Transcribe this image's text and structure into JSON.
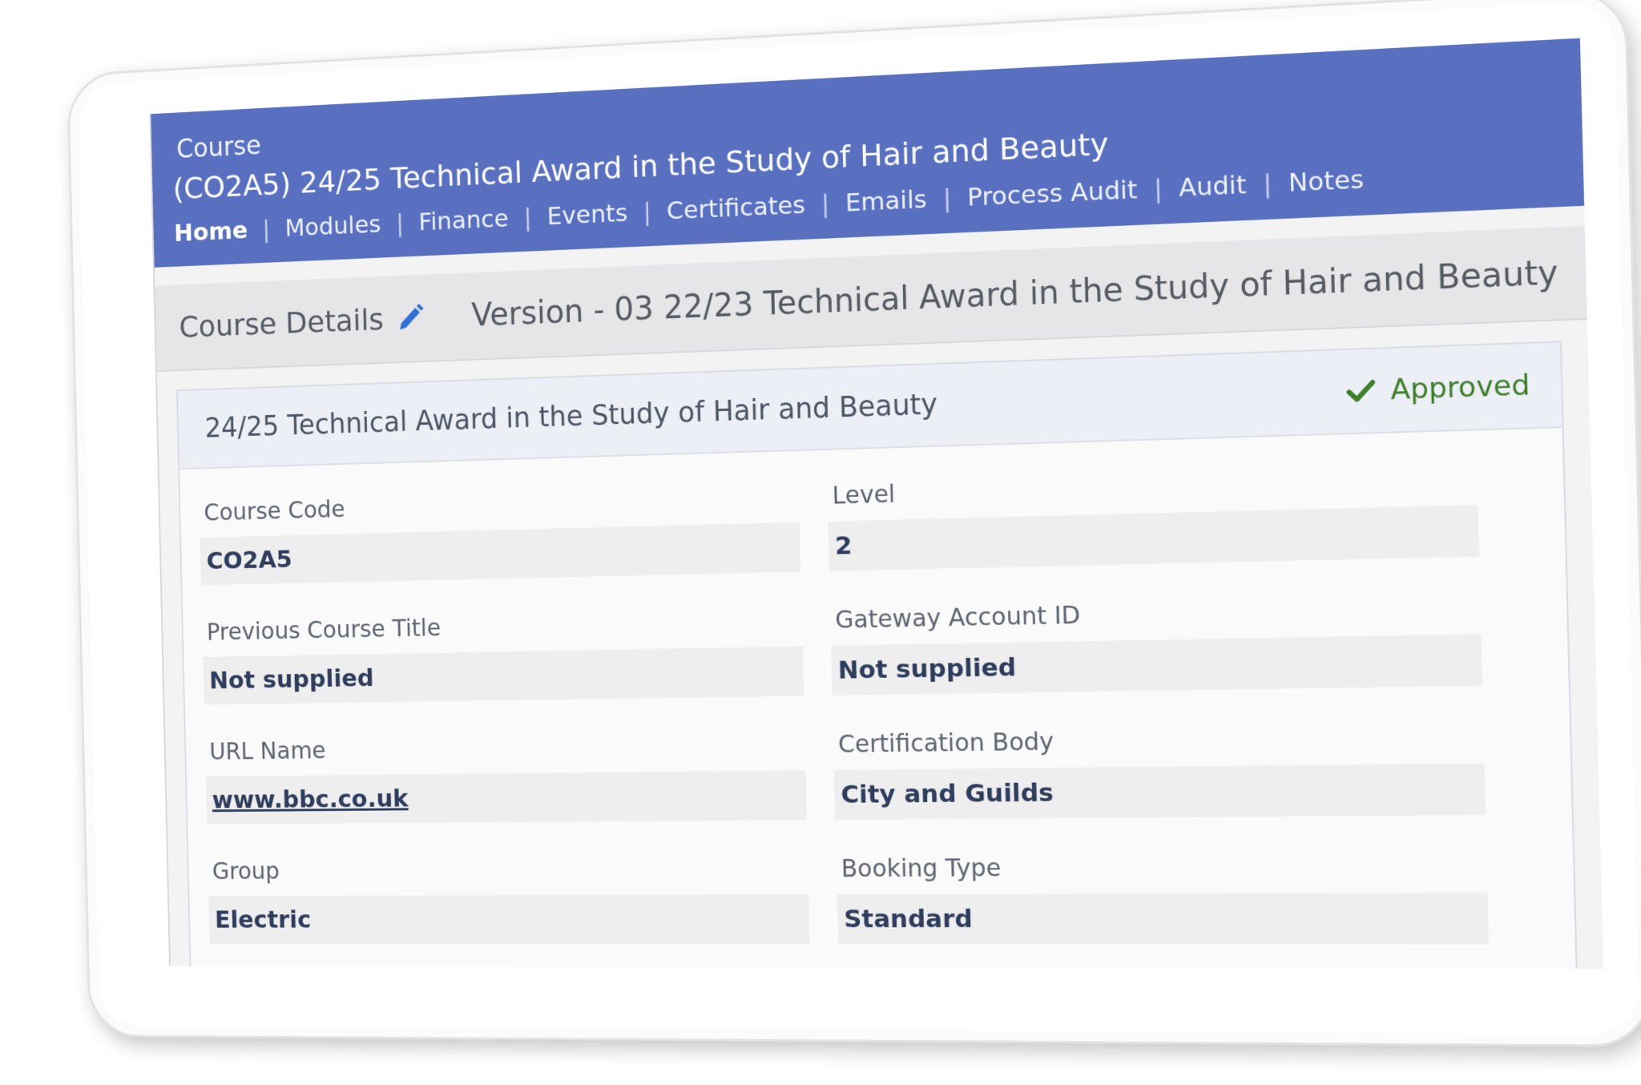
{
  "header": {
    "kicker": "Course",
    "title": "(CO2A5) 24/25 Technical Award in the Study of Hair and Beauty",
    "nav": [
      {
        "label": "Home",
        "active": true
      },
      {
        "label": "Modules",
        "active": false
      },
      {
        "label": "Finance",
        "active": false
      },
      {
        "label": "Events",
        "active": false
      },
      {
        "label": "Certificates",
        "active": false
      },
      {
        "label": "Emails",
        "active": false
      },
      {
        "label": "Process Audit",
        "active": false
      },
      {
        "label": "Audit",
        "active": false
      },
      {
        "label": "Notes",
        "active": false
      }
    ],
    "nav_separator": "|"
  },
  "details_bar": {
    "title": "Course Details",
    "edit_icon": "pencil-icon",
    "version": "Version - 03 22/23 Technical Award in the Study of Hair and Beauty"
  },
  "card": {
    "title": "24/25 Technical Award in the Study of Hair and Beauty",
    "status": "Approved",
    "status_icon": "checkmark-icon",
    "fields": {
      "course_code": {
        "label": "Course Code",
        "value": "CO2A5"
      },
      "level": {
        "label": "Level",
        "value": "2"
      },
      "previous_course_title": {
        "label": "Previous Course Title",
        "value": "Not supplied"
      },
      "gateway_account_id": {
        "label": "Gateway Account ID",
        "value": "Not supplied"
      },
      "url_name": {
        "label": "URL Name",
        "value": "www.bbc.co.uk"
      },
      "certification_body": {
        "label": "Certification Body",
        "value": "City and Guilds"
      },
      "group": {
        "label": "Group",
        "value": "Electric"
      },
      "booking_type": {
        "label": "Booking Type",
        "value": "Standard"
      }
    }
  },
  "colors": {
    "header_bg": "#5870bf",
    "approved": "#3f7f2a",
    "edit_icon": "#2f6fd6"
  }
}
